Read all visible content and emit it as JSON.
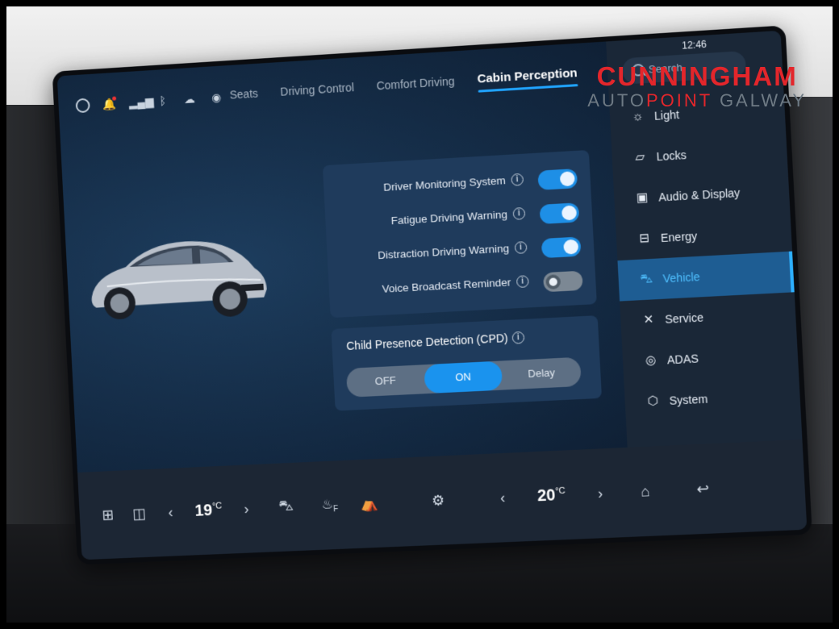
{
  "status_bar": {
    "icons": [
      "person-icon",
      "bell-icon",
      "signal-icon",
      "bluetooth-icon",
      "cloud-icon",
      "location-icon"
    ]
  },
  "tabs": [
    {
      "label": "Seats",
      "active": false
    },
    {
      "label": "Driving Control",
      "active": false
    },
    {
      "label": "Comfort Driving",
      "active": false
    },
    {
      "label": "Cabin Perception",
      "active": true
    }
  ],
  "settings": [
    {
      "label": "Driver Monitoring System",
      "on": true
    },
    {
      "label": "Fatigue Driving Warning",
      "on": true
    },
    {
      "label": "Distraction Driving Warning",
      "on": true
    },
    {
      "label": "Voice Broadcast Reminder",
      "on": false
    }
  ],
  "cpd": {
    "title": "Child Presence Detection (CPD)",
    "options": [
      "OFF",
      "ON",
      "Delay"
    ],
    "selected": "ON"
  },
  "sidebar": {
    "search_placeholder": "Search",
    "clock": "12:46",
    "items": [
      {
        "label": "Light",
        "icon": "sun-icon",
        "active": false
      },
      {
        "label": "Locks",
        "icon": "door-icon",
        "active": false
      },
      {
        "label": "Audio & Display",
        "icon": "display-icon",
        "active": false
      },
      {
        "label": "Energy",
        "icon": "battery-icon",
        "active": false
      },
      {
        "label": "Vehicle",
        "icon": "car-icon",
        "active": true
      },
      {
        "label": "Service",
        "icon": "wrench-icon",
        "active": false
      },
      {
        "label": "ADAS",
        "icon": "steering-wheel-icon",
        "active": false
      },
      {
        "label": "System",
        "icon": "hexagon-icon",
        "active": false
      }
    ]
  },
  "bottom_bar": {
    "left_temp": "19",
    "right_temp": "20",
    "unit": "°C",
    "defrost_label": "F"
  },
  "watermark": {
    "line1": "CUNNINGHAM",
    "line2_a": "AUTO",
    "line2_b": "POINT",
    "line2_c": " GALWAY"
  }
}
